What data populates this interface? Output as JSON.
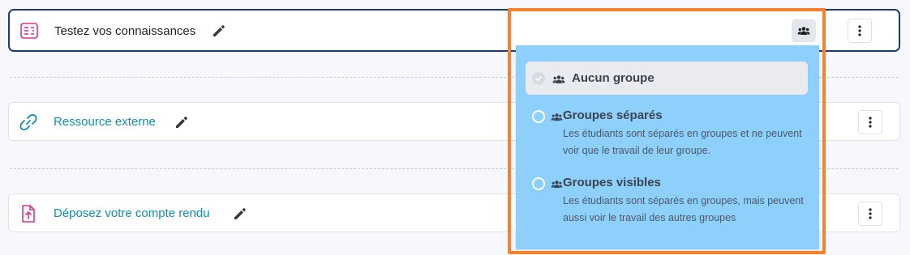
{
  "activities": [
    {
      "title": "Testez vos connaissances",
      "icon": "quiz-icon",
      "accent": "#e3338f"
    },
    {
      "title": "Ressource externe",
      "icon": "link-icon",
      "accent": "#0f8fb5"
    },
    {
      "title": "Déposez votre compte rendu",
      "icon": "file-upload-icon",
      "accent": "#e3338f"
    }
  ],
  "group_menu": {
    "options": [
      {
        "label": "Aucun groupe",
        "selected": true,
        "description": ""
      },
      {
        "label": "Groupes séparés",
        "selected": false,
        "description": "Les étudiants sont séparés en groupes et ne peuvent voir que le travail de leur groupe."
      },
      {
        "label": "Groupes visibles",
        "selected": false,
        "description": "Les étudiants sont séparés en groupes, mais peuvent aussi voir le travail des autres groupes"
      }
    ]
  },
  "colors": {
    "highlight": "#f7822d",
    "dropdown_bg": "#8dd0fc",
    "active_border": "#1f3a78",
    "link": "#0f8fb5"
  }
}
